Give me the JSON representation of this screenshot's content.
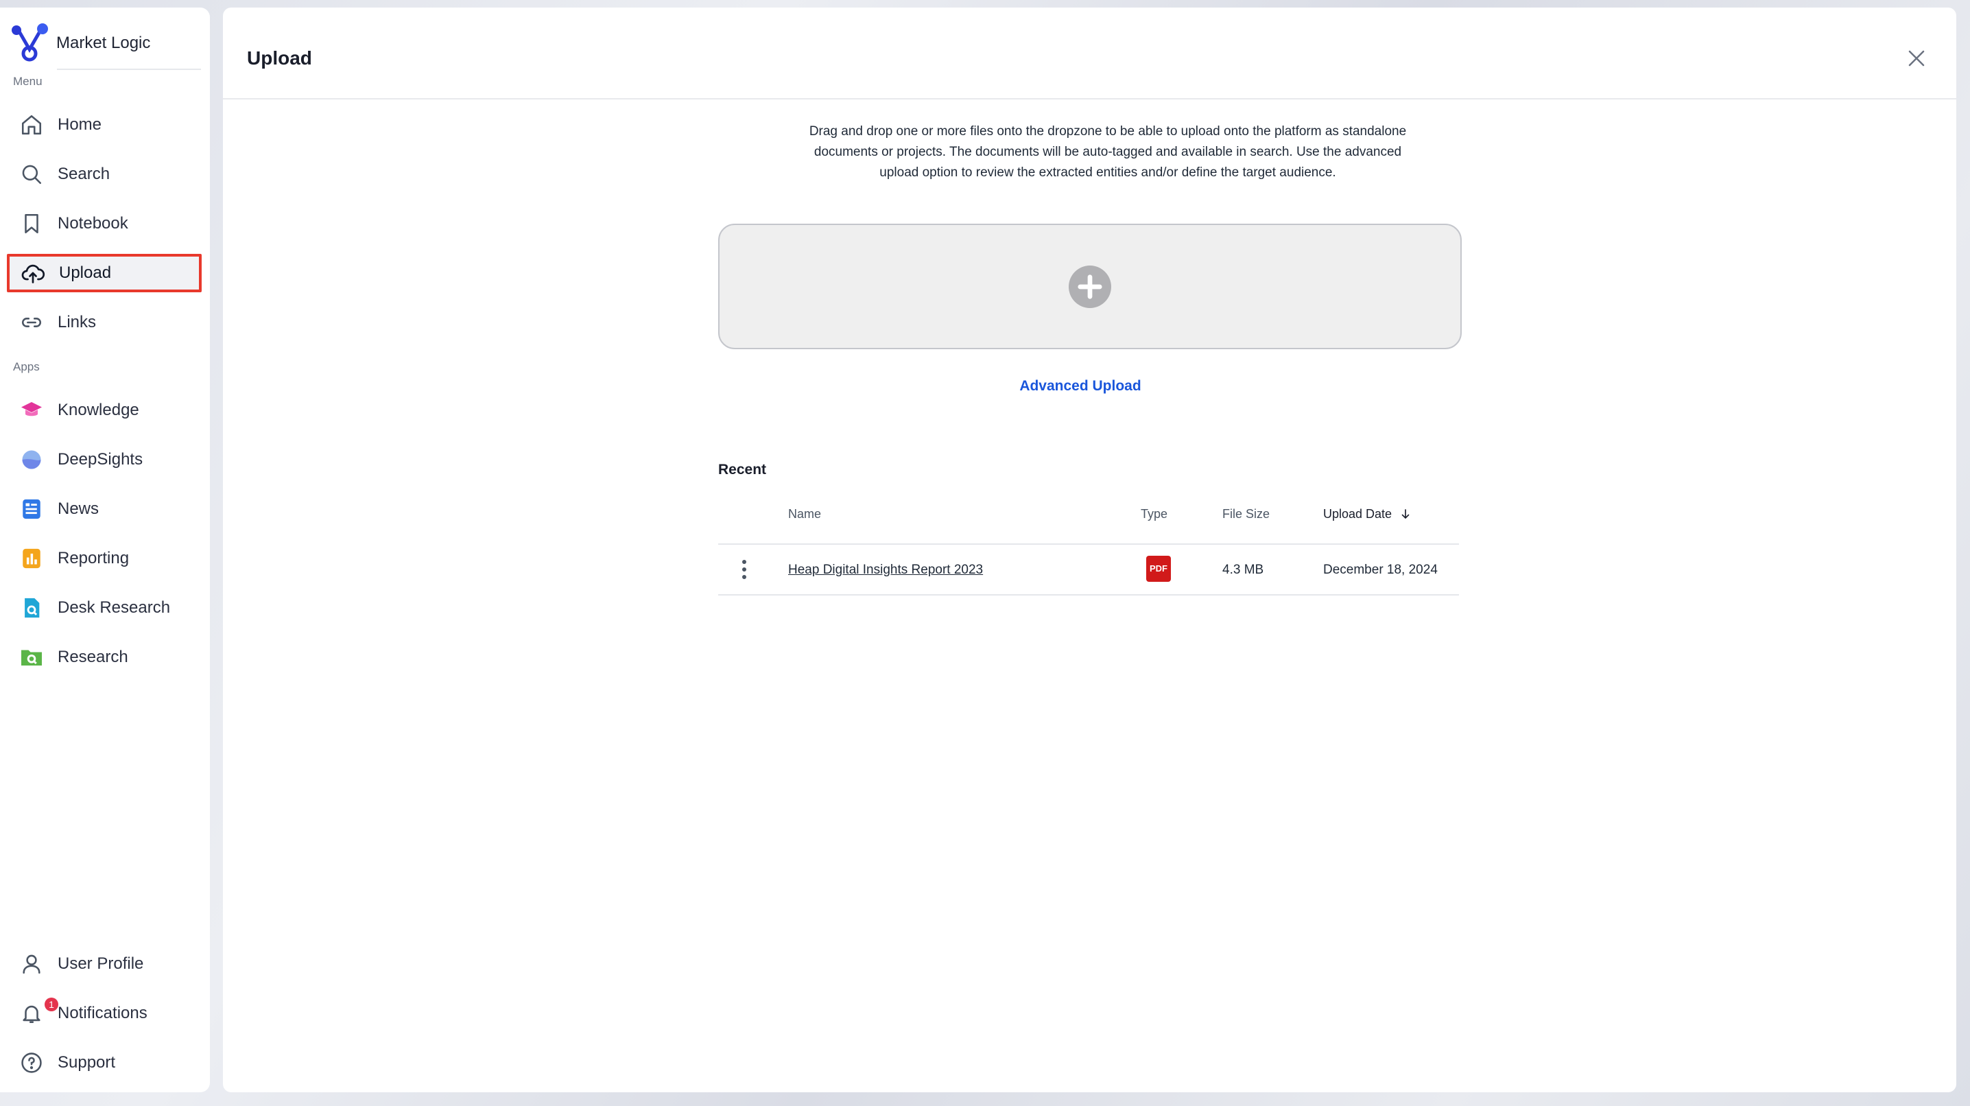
{
  "brand": {
    "name": "Market Logic"
  },
  "sidebar": {
    "menu_label": "Menu",
    "apps_label": "Apps",
    "menu_items": [
      {
        "label": "Home",
        "icon": "home-icon"
      },
      {
        "label": "Search",
        "icon": "search-icon"
      },
      {
        "label": "Notebook",
        "icon": "bookmark-icon"
      },
      {
        "label": "Upload",
        "icon": "cloud-upload-icon",
        "active": true
      },
      {
        "label": "Links",
        "icon": "link-icon"
      }
    ],
    "app_items": [
      {
        "label": "Knowledge",
        "icon": "graduation-cap-icon"
      },
      {
        "label": "DeepSights",
        "icon": "deepsights-icon"
      },
      {
        "label": "News",
        "icon": "news-icon"
      },
      {
        "label": "Reporting",
        "icon": "bar-chart-icon"
      },
      {
        "label": "Desk Research",
        "icon": "desk-research-icon"
      },
      {
        "label": "Research",
        "icon": "research-folder-icon"
      }
    ],
    "bottom_items": [
      {
        "label": "User Profile",
        "icon": "user-icon"
      },
      {
        "label": "Notifications",
        "icon": "bell-icon",
        "badge": "1"
      },
      {
        "label": "Support",
        "icon": "help-circle-icon"
      }
    ]
  },
  "main": {
    "title": "Upload",
    "description": "Drag and drop one or more files onto the dropzone to be able to upload onto the platform as standalone documents or projects. The documents will be auto-tagged and available in search. Use the advanced upload option to review the extracted entities and/or define the target audience.",
    "advanced_upload_label": "Advanced Upload",
    "recent_title": "Recent",
    "columns": {
      "name": "Name",
      "type": "Type",
      "file_size": "File Size",
      "upload_date": "Upload Date"
    },
    "rows": [
      {
        "name": "Heap Digital Insights Report 2023",
        "type": "PDF",
        "file_size": "4.3 MB",
        "upload_date": "December 18, 2024"
      }
    ]
  },
  "colors": {
    "accent_link": "#1a56db",
    "active_outline": "#e8392c",
    "pdf_red": "#d11a1a",
    "badge_red": "#e4344d"
  }
}
